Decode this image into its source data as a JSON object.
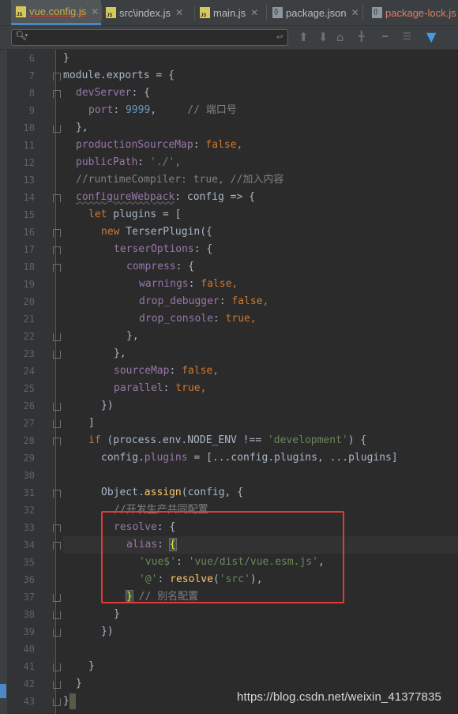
{
  "tabs": [
    {
      "label": "vue.config.js",
      "icon": "js-file-icon",
      "active": true
    },
    {
      "label": "src\\index.js",
      "icon": "js-file-icon",
      "active": false
    },
    {
      "label": "main.js",
      "icon": "js-file-icon",
      "active": false
    },
    {
      "label": "package.json",
      "icon": "json-file-icon",
      "active": false
    },
    {
      "label": "package-lock.js",
      "icon": "json-file-icon",
      "active": false
    }
  ],
  "search": {
    "placeholder": "",
    "value": ""
  },
  "line_numbers": [
    "6",
    "7",
    "8",
    "9",
    "10",
    "11",
    "12",
    "13",
    "14",
    "15",
    "16",
    "17",
    "18",
    "19",
    "20",
    "21",
    "22",
    "23",
    "24",
    "25",
    "26",
    "27",
    "28",
    "29",
    "30",
    "31",
    "32",
    "33",
    "34",
    "35",
    "36",
    "37",
    "38",
    "39",
    "40",
    "41",
    "42",
    "43"
  ],
  "code": {
    "l6": "}",
    "l7a": "module",
    "l7b": ".",
    "l7c": "exports",
    "l7d": " = {",
    "l8a": "devServer",
    "l8b": ": {",
    "l9a": "port",
    "l9b": ": ",
    "l9c": "9999",
    "l9d": ",     ",
    "l9e": "// 端口号",
    "l10": "},",
    "l11a": "productionSourceMap",
    "l11b": ": ",
    "l11c": "false",
    "l11d": ",",
    "l12a": "publicPath",
    "l12b": ": ",
    "l12c": "'./'",
    "l12d": ",",
    "l13": "//runtimeCompiler: true, //加入内容",
    "l14a": "configureWebpack",
    "l14b": ": config => {",
    "l15a": "let",
    "l15b": " plugins = [",
    "l16a": "new",
    "l16b": " TerserPlugin({",
    "l17a": "terserOptions",
    "l17b": ": {",
    "l18a": "compress",
    "l18b": ": {",
    "l19a": "warnings",
    "l19b": ": ",
    "l19c": "false",
    "l19d": ",",
    "l20a": "drop_debugger",
    "l20b": ": ",
    "l20c": "false",
    "l20d": ",",
    "l21a": "drop_console",
    "l21b": ": ",
    "l21c": "true",
    "l21d": ",",
    "l22": "},",
    "l23": "},",
    "l24a": "sourceMap",
    "l24b": ": ",
    "l24c": "false",
    "l24d": ",",
    "l25a": "parallel",
    "l25b": ": ",
    "l25c": "true",
    "l25d": ",",
    "l26": "})",
    "l27": "]",
    "l28a": "if",
    "l28b": " (process.env.NODE_ENV !== ",
    "l28c": "'development'",
    "l28d": ") {",
    "l29a": "config",
    "l29b": ".",
    "l29c": "plugins",
    "l29d": " = [...config.plugins, ...plugins]",
    "l30": "",
    "l31a": "Object",
    "l31b": ".",
    "l31c": "assign",
    "l31d": "(config, {",
    "l32": "//开发生产共同配置",
    "l33a": "resolve",
    "l33b": ": {",
    "l34a": "alias",
    "l34b": ": ",
    "l34c": "{",
    "l35a": "'vue$'",
    "l35b": ": ",
    "l35c": "'vue/dist/vue.esm.js'",
    "l35d": ",",
    "l36a": "'@'",
    "l36b": ": ",
    "l36c": "resolve",
    "l36d": "(",
    "l36e": "'src'",
    "l36f": "),",
    "l37a": "}",
    "l37b": " ",
    "l37c": "// 别名配置",
    "l38": "}",
    "l39": "})",
    "l40": "",
    "l41": "}",
    "l42": "}",
    "l43": "}"
  },
  "watermark": "https://blog.csdn.net/weixin_41377835",
  "colors": {
    "keyword": "#cc7832",
    "property": "#9876aa",
    "number": "#6897bb",
    "string": "#6a8759",
    "comment": "#808080",
    "function": "#ffc66d",
    "highlight_box": "#e03a3a"
  }
}
